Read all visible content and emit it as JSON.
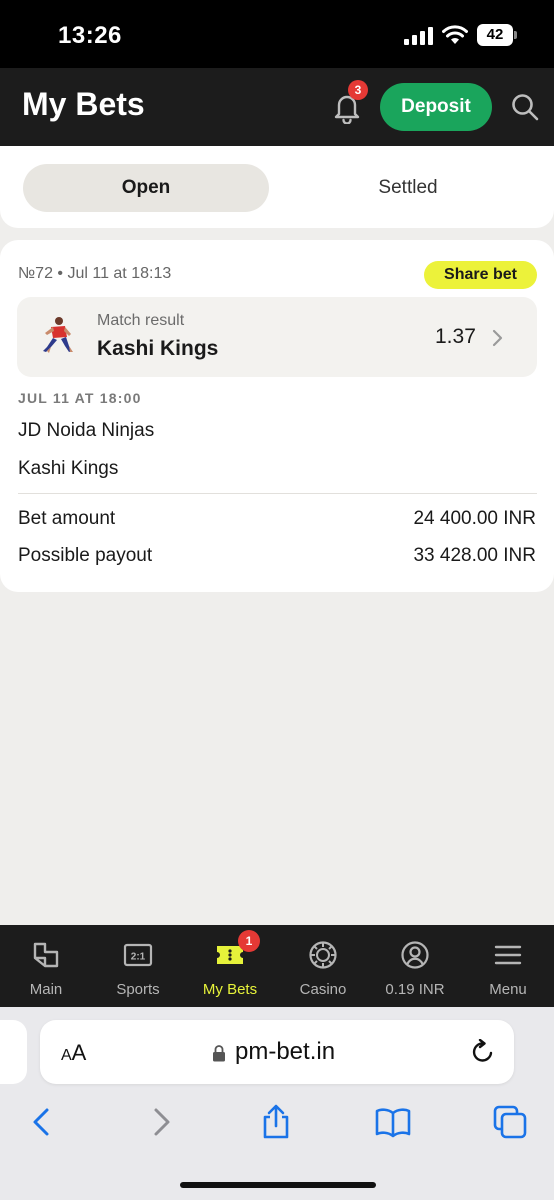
{
  "status_bar": {
    "time": "13:26",
    "battery": "42"
  },
  "header": {
    "title": "My Bets",
    "notification_count": "3",
    "deposit_label": "Deposit"
  },
  "tabs": [
    {
      "label": "Open",
      "active": true
    },
    {
      "label": "Settled",
      "active": false
    }
  ],
  "bet": {
    "meta": "№72 • Jul 11 at 18:13",
    "share_label": "Share bet",
    "market": "Match result",
    "selection": "Kashi Kings",
    "odds": "1.37",
    "event_date": "JUL 11 AT 18:00",
    "team_home": "JD Noida Ninjas",
    "team_away": "Kashi Kings",
    "bet_amount_label": "Bet amount",
    "bet_amount_value": "24 400.00 INR",
    "payout_label": "Possible payout",
    "payout_value": "33 428.00 INR"
  },
  "bottom_nav": {
    "items": [
      {
        "label": "Main",
        "icon": "main-icon"
      },
      {
        "label": "Sports",
        "icon": "sports-icon"
      },
      {
        "label": "My Bets",
        "icon": "ticket-icon",
        "active": true,
        "badge": "1"
      },
      {
        "label": "Casino",
        "icon": "casino-chip-icon"
      },
      {
        "label": "0.19 INR",
        "icon": "profile-icon"
      },
      {
        "label": "Menu",
        "icon": "hamburger-icon"
      }
    ]
  },
  "browser": {
    "text_size_label_small": "A",
    "text_size_label_large": "A",
    "url": "pm-bet.in"
  },
  "colors": {
    "accent_green": "#1aa55c",
    "accent_yellow": "#e6f23a",
    "badge_red": "#e53935",
    "ios_blue": "#1a73e8"
  }
}
